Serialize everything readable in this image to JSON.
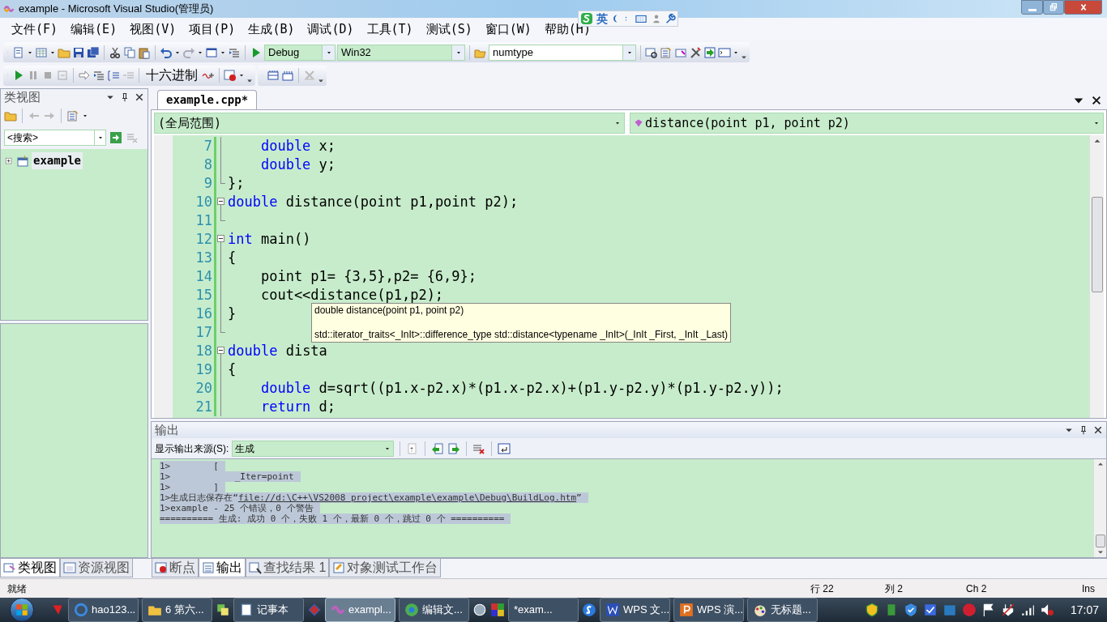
{
  "window": {
    "title": "example - Microsoft Visual Studio(管理员)"
  },
  "ime_bar": {
    "mode": "英"
  },
  "menu": [
    "文件(F)",
    "编辑(E)",
    "视图(V)",
    "项目(P)",
    "生成(B)",
    "调试(D)",
    "工具(T)",
    "测试(S)",
    "窗口(W)",
    "帮助(H)"
  ],
  "toolbar": {
    "configuration": "Debug",
    "platform": "Win32",
    "find": "numtype",
    "hex_button": "十六进制"
  },
  "class_view": {
    "title": "类视图",
    "search_placeholder": "<搜索>",
    "tree": [
      {
        "label": "example",
        "expanded": false,
        "selected": true
      }
    ]
  },
  "editor": {
    "tabs": [
      {
        "label": "example.cpp*",
        "selected": true
      }
    ],
    "scope": "(全局范围)",
    "member": "distance(point p1, point p2)",
    "lines": [
      {
        "number": "7",
        "kind": "inner",
        "segments": [
          {
            "kind": "keyword",
            "text": "    double"
          },
          {
            "kind": "plain",
            "text": " x;"
          }
        ]
      },
      {
        "number": "8",
        "kind": "inner",
        "segments": [
          {
            "kind": "keyword",
            "text": "    double"
          },
          {
            "kind": "plain",
            "text": " y;"
          }
        ]
      },
      {
        "number": "9",
        "kind": "end",
        "segments": [
          {
            "kind": "plain",
            "text": "};"
          }
        ]
      },
      {
        "number": "10",
        "kind": "start",
        "segments": [
          {
            "kind": "keyword",
            "text": "double"
          },
          {
            "kind": "plain",
            "text": " distance(point p1,point p2);"
          }
        ]
      },
      {
        "number": "11",
        "kind": "end"
      },
      {
        "number": "12",
        "kind": "start",
        "segments": [
          {
            "kind": "keyword",
            "text": "int"
          },
          {
            "kind": "plain",
            "text": " main()"
          }
        ]
      },
      {
        "number": "13",
        "kind": "inner",
        "segments": [
          {
            "kind": "plain",
            "text": "{"
          }
        ]
      },
      {
        "number": "14",
        "kind": "inner",
        "segments": [
          {
            "kind": "plain",
            "text": "    point p1= {3,5},p2= {6,9};"
          }
        ]
      },
      {
        "number": "15",
        "kind": "inner",
        "segments": [
          {
            "kind": "plain",
            "text": "    cout<<distance(p1,p2);"
          }
        ]
      },
      {
        "number": "16",
        "kind": "inner",
        "segments": [
          {
            "kind": "plain",
            "text": "}"
          }
        ]
      },
      {
        "number": "17",
        "kind": "end"
      },
      {
        "number": "18",
        "kind": "start",
        "segments": [
          {
            "kind": "keyword",
            "text": "double"
          },
          {
            "kind": "plain",
            "text": " dista"
          }
        ]
      },
      {
        "number": "19",
        "kind": "inner",
        "segments": [
          {
            "kind": "plain",
            "text": "{"
          }
        ]
      },
      {
        "number": "20",
        "kind": "inner",
        "segments": [
          {
            "kind": "keyword",
            "text": "    double"
          },
          {
            "kind": "plain",
            "text": " d=sqrt((p1.x-p2.x)*(p1.x-p2.x)+(p1.y-p2.y)*(p1.y-p2.y));"
          }
        ]
      },
      {
        "number": "21",
        "kind": "inner",
        "segments": [
          {
            "kind": "keyword",
            "text": "    return"
          },
          {
            "kind": "plain",
            "text": " d;"
          }
        ]
      }
    ],
    "tooltip": [
      "double distance(point p1, point p2)",
      "std::iterator_traits<_InIt>::difference_type std::distance<typename _InIt>(_InIt _First, _InIt _Last)"
    ]
  },
  "output": {
    "title": "输出",
    "source_label": "显示输出来源(S):",
    "source": "生成",
    "lines": [
      {
        "text": "1>        ["
      },
      {
        "text": "1>            _Iter=point"
      },
      {
        "text": "1>        ]"
      },
      {
        "text": "1>生成日志保存在“",
        "link": "file://d:\\C++\\VS2008 project\\example\\example\\Debug\\BuildLog.htm",
        "after": "”"
      },
      {
        "text": "1>example - 25 个错误，0 个警告"
      },
      {
        "text": "========== 生成: 成功 0 个，失败 1 个，最新 0 个，跳过 0 个 =========="
      }
    ]
  },
  "left_tabs": [
    {
      "label": "类视图",
      "selected": true
    },
    {
      "label": "资源视图",
      "selected": false
    }
  ],
  "bottom_tabs": [
    {
      "label": "断点",
      "selected": false
    },
    {
      "label": "输出",
      "selected": true
    },
    {
      "label": "查找结果 1",
      "selected": false
    },
    {
      "label": "对象测试工作台",
      "selected": false
    }
  ],
  "status_bar": {
    "message": "就绪",
    "line": "行 22",
    "column": "列 2",
    "char": "Ch 2",
    "mode": "Ins"
  },
  "taskbar": {
    "items": [
      {
        "label": "hao123...",
        "selected": false
      },
      {
        "label": "6 第六...",
        "selected": false
      },
      {
        "label": "记事本",
        "selected": false
      },
      {
        "label": "exampl...",
        "selected": true
      },
      {
        "label": "编辑文...",
        "selected": false
      },
      {
        "label": "*exam...",
        "selected": false
      },
      {
        "label": "WPS 文...",
        "selected": false
      },
      {
        "label": "WPS 演...",
        "selected": false
      },
      {
        "label": "无标题...",
        "selected": false
      }
    ],
    "clock": "17:07"
  }
}
